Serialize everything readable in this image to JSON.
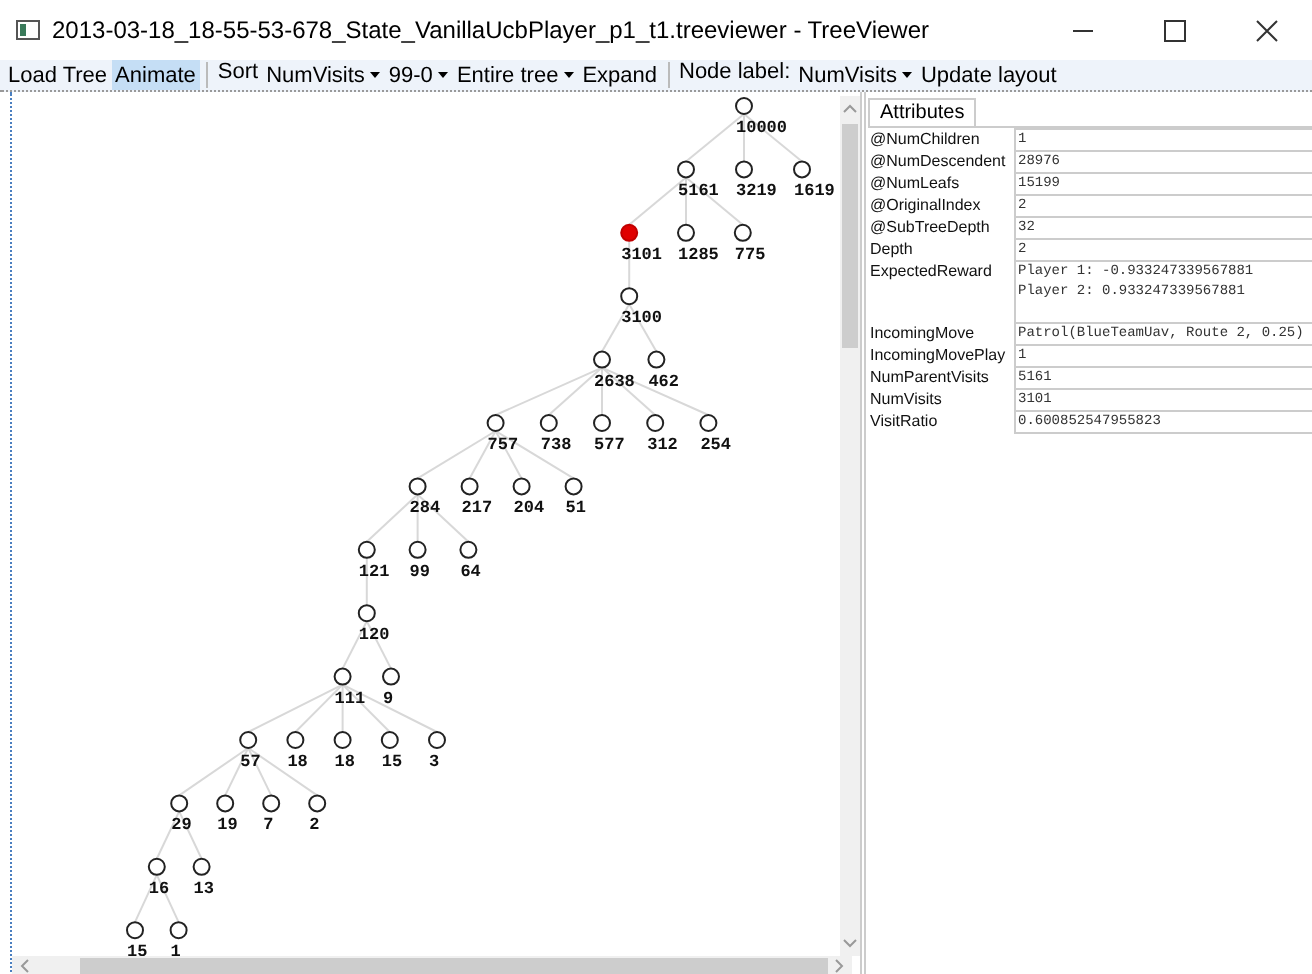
{
  "window": {
    "title": "2013-03-18_18-55-53-678_State_VanillaUcbPlayer_p1_t1.treeviewer - TreeViewer"
  },
  "toolbar": [
    {
      "kind": "button",
      "label": "Load Tree",
      "selected": false
    },
    {
      "kind": "button",
      "label": "Animate",
      "selected": true
    },
    {
      "kind": "separator"
    },
    {
      "kind": "label",
      "label": "Sort"
    },
    {
      "kind": "dropdown",
      "label": "NumVisits"
    },
    {
      "kind": "dropdown",
      "label": "99-0"
    },
    {
      "kind": "dropdown",
      "label": "Entire tree"
    },
    {
      "kind": "button",
      "label": "Expand",
      "selected": false
    },
    {
      "kind": "separator"
    },
    {
      "kind": "label",
      "label": "Node label:"
    },
    {
      "kind": "dropdown",
      "label": "NumVisits"
    },
    {
      "kind": "button",
      "label": "Update layout",
      "selected": false
    }
  ],
  "tree": {
    "label": "10000",
    "selected": false,
    "children": [
      {
        "label": "5161",
        "selected": false,
        "children": [
          {
            "label": "3101",
            "selected": true,
            "children": [
              {
                "label": "3100",
                "selected": false,
                "children": [
                  {
                    "label": "2638",
                    "selected": false,
                    "children": [
                      {
                        "label": "757",
                        "selected": false,
                        "children": [
                          {
                            "label": "284",
                            "selected": false,
                            "children": [
                              {
                                "label": "121",
                                "selected": false,
                                "children": [
                                  {
                                    "label": "120",
                                    "selected": false,
                                    "children": [
                                      {
                                        "label": "111",
                                        "selected": false,
                                        "children": [
                                          {
                                            "label": "57",
                                            "selected": false,
                                            "children": [
                                              {
                                                "label": "29",
                                                "selected": false,
                                                "children": [
                                                  {
                                                    "label": "16",
                                                    "selected": false,
                                                    "children": [
                                                      {
                                                        "label": "15",
                                                        "selected": false
                                                      },
                                                      {
                                                        "label": "1",
                                                        "selected": false
                                                      }
                                                    ]
                                                  },
                                                  {
                                                    "label": "13",
                                                    "selected": false
                                                  }
                                                ]
                                              },
                                              {
                                                "label": "19",
                                                "selected": false
                                              },
                                              {
                                                "label": "7",
                                                "selected": false
                                              },
                                              {
                                                "label": "2",
                                                "selected": false
                                              }
                                            ]
                                          },
                                          {
                                            "label": "18",
                                            "selected": false
                                          },
                                          {
                                            "label": "18",
                                            "selected": false
                                          },
                                          {
                                            "label": "15",
                                            "selected": false
                                          },
                                          {
                                            "label": "3",
                                            "selected": false
                                          }
                                        ]
                                      },
                                      {
                                        "label": "9",
                                        "selected": false
                                      }
                                    ]
                                  }
                                ]
                              },
                              {
                                "label": "99",
                                "selected": false
                              },
                              {
                                "label": "64",
                                "selected": false
                              }
                            ]
                          },
                          {
                            "label": "217",
                            "selected": false
                          },
                          {
                            "label": "204",
                            "selected": false
                          },
                          {
                            "label": "51",
                            "selected": false
                          }
                        ]
                      },
                      {
                        "label": "738",
                        "selected": false
                      },
                      {
                        "label": "577",
                        "selected": false
                      },
                      {
                        "label": "312",
                        "selected": false
                      },
                      {
                        "label": "254",
                        "selected": false
                      }
                    ]
                  },
                  {
                    "label": "462",
                    "selected": false
                  }
                ]
              }
            ]
          },
          {
            "label": "1285",
            "selected": false
          },
          {
            "label": "775",
            "selected": false
          }
        ]
      },
      {
        "label": "3219",
        "selected": false
      },
      {
        "label": "1619",
        "selected": false
      }
    ]
  },
  "attributes_panel": {
    "tab": "Attributes",
    "properties": [
      {
        "name": "@NumChildren",
        "value": "1"
      },
      {
        "name": "@NumDescendent",
        "value": "28976"
      },
      {
        "name": "@NumLeafs",
        "value": "15199"
      },
      {
        "name": "@OriginalIndex",
        "value": "2"
      },
      {
        "name": "@SubTreeDepth",
        "value": "32"
      },
      {
        "name": "Depth",
        "value": "2"
      },
      {
        "name": "ExpectedReward",
        "value": "Player 1: -0.933247339567881\nPlayer 2: 0.933247339567881"
      },
      {
        "name": "IncomingMove",
        "value": "Patrol(BlueTeamUav, Route 2, 0.25)"
      },
      {
        "name": "IncomingMovePlay",
        "value": "1"
      },
      {
        "name": "NumParentVisits",
        "value": "5161"
      },
      {
        "name": "NumVisits",
        "value": "3101"
      },
      {
        "name": "VisitRatio",
        "value": "0.600852547955823"
      }
    ]
  }
}
